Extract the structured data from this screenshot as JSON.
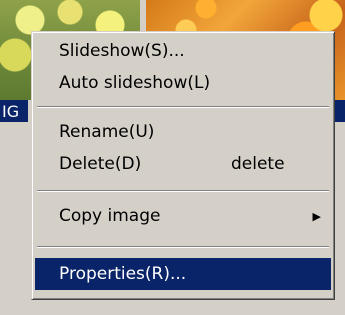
{
  "background": {
    "selected_item_partial_label": "IG"
  },
  "context_menu": {
    "items": [
      {
        "label": "Slideshow(S)..."
      },
      {
        "label": "Auto slideshow(L)"
      },
      {
        "label": "Rename(U)"
      },
      {
        "label": "Delete(D)",
        "shortcut": "delete"
      },
      {
        "label": "Copy image",
        "submenu_icon": "submenu-arrow-icon"
      },
      {
        "label": "Properties(R)..."
      }
    ],
    "highlighted_index": 5,
    "highlight_color": "#0a246a",
    "menu_color": "#d4d0c8"
  }
}
